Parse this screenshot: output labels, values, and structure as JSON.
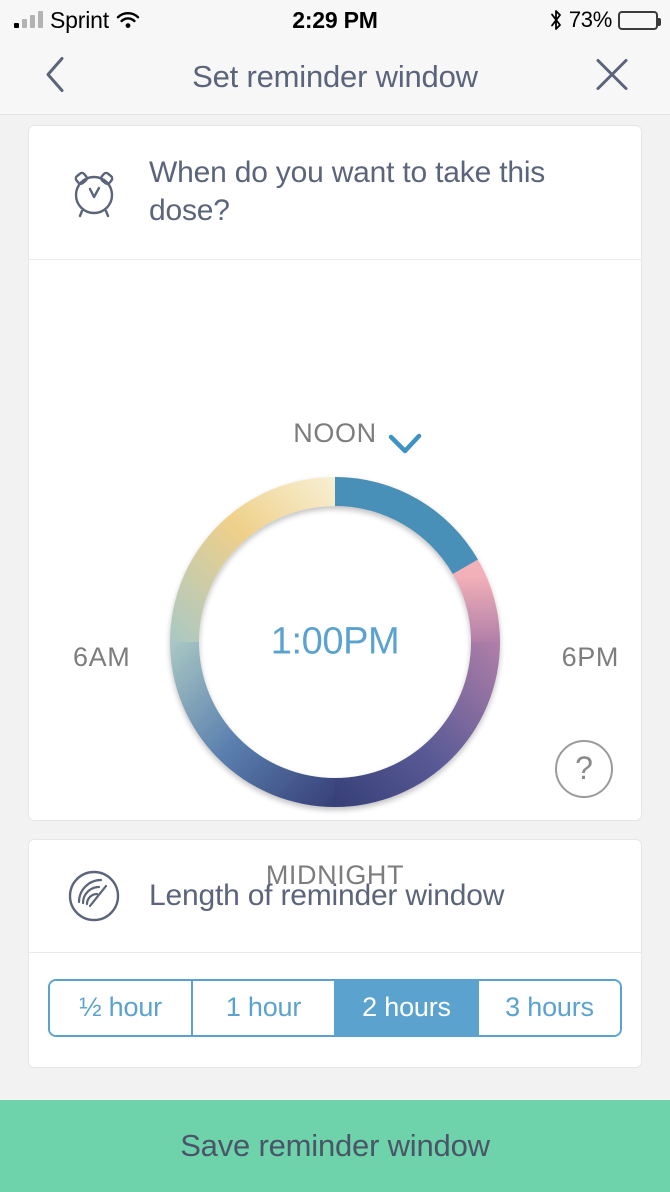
{
  "status_bar": {
    "carrier": "Sprint",
    "time": "2:29 PM",
    "battery_percent": "73%",
    "battery_level": 73,
    "icons": [
      "signal-bars-icon",
      "wifi-icon",
      "bluetooth-icon",
      "battery-icon"
    ]
  },
  "header": {
    "title": "Set reminder window",
    "back_icon": "chevron-left-icon",
    "close_icon": "close-icon"
  },
  "dose_card": {
    "icon": "alarm-clock-icon",
    "question": "When do you want to take this dose?",
    "dial": {
      "selected_time": "1:00PM",
      "label_top": "NOON",
      "label_bottom": "MIDNIGHT",
      "label_left": "6AM",
      "label_right": "6PM",
      "marker_icon": "chevron-down-marker-icon",
      "selection_start_hour": 12,
      "selection_end_hour": 14,
      "selection_color": "#4a90b8",
      "time_text_color": "#5ba3ce",
      "gradient_stops": {
        "noon": "#f7f0d5",
        "nine_am": "#efd08a",
        "six_am": "#a9c8c4",
        "three_am": "#5a7fae",
        "midnight": "#363f77",
        "nine_pm": "#5a5a96",
        "six_pm": "#f2b0b8",
        "three_pm": "#f5bcc1"
      }
    },
    "help_label": "?"
  },
  "length_card": {
    "icon": "signal-range-icon",
    "title": "Length of reminder window",
    "options": [
      {
        "label": "½ hour",
        "selected": false
      },
      {
        "label": "1 hour",
        "selected": false
      },
      {
        "label": "2 hours",
        "selected": true
      },
      {
        "label": "3 hours",
        "selected": false
      }
    ],
    "accent_color": "#5ba3ce"
  },
  "footer": {
    "save_label": "Save reminder window",
    "save_color": "#6ed3ab"
  }
}
